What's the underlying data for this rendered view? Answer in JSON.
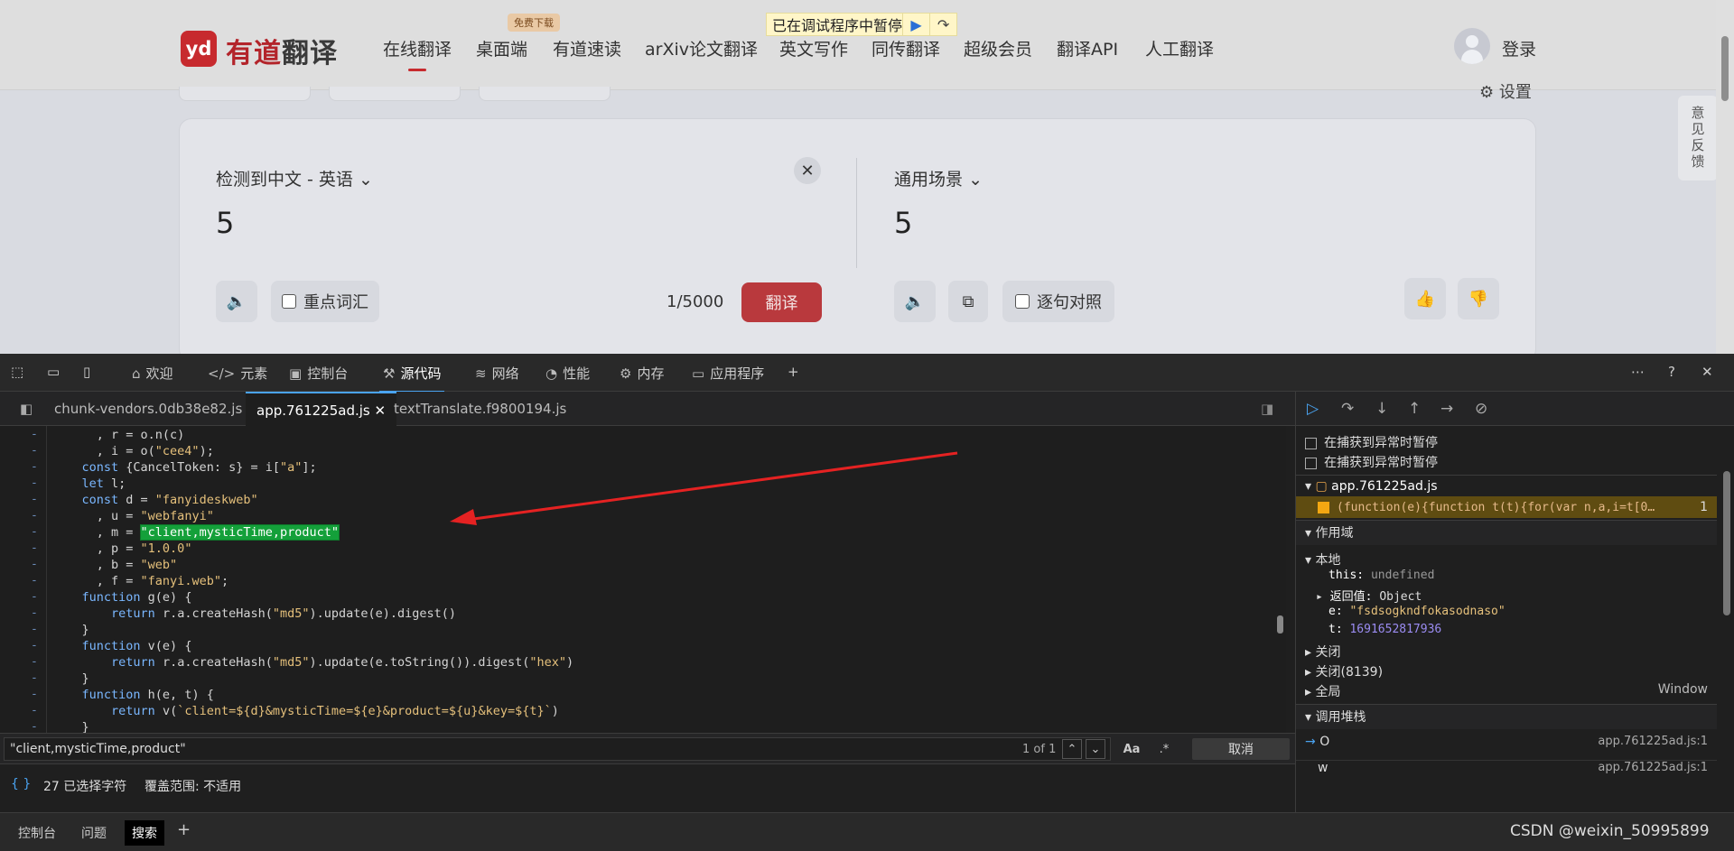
{
  "site": {
    "logo_mark": "yd",
    "logo_brand": "有道",
    "logo_product": "翻译",
    "nav": [
      "在线翻译",
      "桌面端",
      "有道速读",
      "arXiv论文翻译",
      "英文写作",
      "同传翻译",
      "超级会员",
      "翻译API",
      "人工翻译"
    ],
    "free_badge": "免费下载",
    "login": "登录",
    "feedback": "意见反馈",
    "settings": "设置",
    "debugger_paused": "已在调试程序中暂停"
  },
  "translator": {
    "source_lang": "检测到中文 - 英语",
    "scene": "通用场景",
    "input_value": "5",
    "output_value": "5",
    "key_words": "重点词汇",
    "char_count": "1/5000",
    "translate_button": "翻译",
    "sentence_compare": "逐句对照"
  },
  "devtools": {
    "tabs": [
      "欢迎",
      "元素",
      "控制台",
      "源代码",
      "网络",
      "性能",
      "内存",
      "应用程序"
    ],
    "active_tab": "源代码",
    "files": [
      "chunk-vendors.0db38e82.js",
      "app.761225ad.js",
      "textTranslate.f9800194.js"
    ],
    "code_lines": [
      "      , r = o.n(c)",
      "      , i = o(\"cee4\");",
      "    const {CancelToken: s} = i[\"a\"];",
      "    let l;",
      "    const d = \"fanyideskweb\"",
      "      , u = \"webfanyi\"",
      "      , m = \"client,mysticTime,product\"",
      "      , p = \"1.0.0\"",
      "      , b = \"web\"",
      "      , f = \"fanyi.web\";",
      "    function g(e) {",
      "        return r.a.createHash(\"md5\").update(e).digest()",
      "    }",
      "    function v(e) {",
      "        return r.a.createHash(\"md5\").update(e.toString()).digest(\"hex\")",
      "    }",
      "    function h(e, t) {",
      "        return v(`client=${d}&mysticTime=${e}&product=${u}&key=${t}`)",
      "    }"
    ],
    "search": {
      "value": "\"client,mysticTime,product\"",
      "match_count": "1 of 1",
      "case_label": "Aa",
      "regex_label": ".*",
      "cancel": "取消"
    },
    "status": {
      "braces": "{ }",
      "selected": "27 已选择字符",
      "coverage": "覆盖范围: 不适用"
    },
    "drawer_tabs": [
      "控制台",
      "问题",
      "搜索"
    ],
    "watermark": "CSDN @weixin_50995899",
    "debugger": {
      "pause_on_caught": "在捕获到异常时暂停",
      "pause_on_uncaught": "在捕获到异常时暂停",
      "breakpoint_file": "app.761225ad.js",
      "breakpoint_code": "(function(e){function t(t){for(var n,a,i=t[0…",
      "breakpoint_line": "1",
      "scope_title": "作用域",
      "local_title": "本地",
      "this_label": "this:",
      "this_value": "undefined",
      "return_label": "返回值:",
      "return_value": "Object",
      "e_label": "e:",
      "e_value": "\"fsdsogkndfokasodnaso\"",
      "t_label": "t:",
      "t_value": "1691652817936",
      "closure": "关闭",
      "closure2": "关闭(8139)",
      "global": "全局",
      "global_value": "Window",
      "callstack_title": "调用堆栈",
      "stack": [
        {
          "fn": "O",
          "loc": "app.761225ad.js:1"
        },
        {
          "fn": "w",
          "loc": "app.761225ad.js:1"
        }
      ]
    }
  }
}
